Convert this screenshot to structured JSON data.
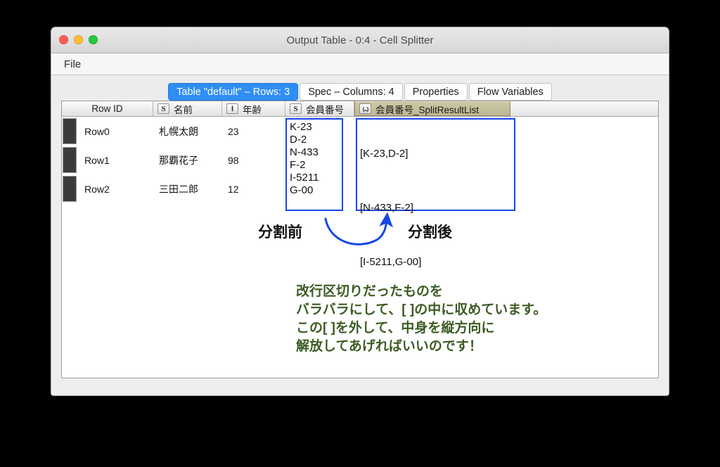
{
  "window": {
    "title": "Output Table - 0:4 - Cell Splitter",
    "traffic_lights": [
      "close-button",
      "minimize-button",
      "zoom-button"
    ]
  },
  "menubar": {
    "items": [
      {
        "label": "File"
      }
    ]
  },
  "tabs": [
    {
      "label": "Table \"default\" – Rows: 3",
      "active": true
    },
    {
      "label": "Spec – Columns: 4",
      "active": false
    },
    {
      "label": "Properties",
      "active": false
    },
    {
      "label": "Flow Variables",
      "active": false
    }
  ],
  "table": {
    "columns": [
      {
        "id": "rowid",
        "label": "Row ID",
        "type_icon": "",
        "selected": false
      },
      {
        "id": "name",
        "label": "名前",
        "type_icon": "S",
        "selected": false
      },
      {
        "id": "age",
        "label": "年齢",
        "type_icon": "I",
        "selected": false
      },
      {
        "id": "member",
        "label": "会員番号",
        "type_icon": "S",
        "selected": false
      },
      {
        "id": "split",
        "label": "会員番号_SplitResultList",
        "type_icon": "(...)",
        "selected": true
      }
    ],
    "rows": [
      {
        "rowid": "Row0",
        "name": "札幌太朗",
        "age": "23",
        "member": "K-23\nD-2",
        "split": "[K-23,D-2]"
      },
      {
        "rowid": "Row1",
        "name": "那覇花子",
        "age": "98",
        "member": "N-433\nF-2",
        "split": "[N-433,F-2]"
      },
      {
        "rowid": "Row2",
        "name": "三田二郎",
        "age": "12",
        "member": "I-5211\nG-00",
        "split": "[I-5211,G-00]"
      }
    ]
  },
  "annotations": {
    "label_before": "分割前",
    "label_after": "分割後",
    "arrow": "curved-arrow-left-to-right",
    "note_lines": [
      "改行区切りだったものを",
      "バラバラにして、[ ]の中に収めています。",
      "この[ ]を外して、中身を縦方向に",
      "解放してあげればいいのです！"
    ],
    "note_text": "改行区切りだったものを\nバラバラにして、[ ]の中に収めています。\nこの[ ]を外して、中身を縦方向に\n解放してあげればいいのです！"
  },
  "colors": {
    "accent_tab": "#2f8ef4",
    "annotation_blue": "#1547e8",
    "note_green": "#3c5b23",
    "selected_header": "#c5c09c",
    "row_swatch": "#3b3b3b"
  }
}
